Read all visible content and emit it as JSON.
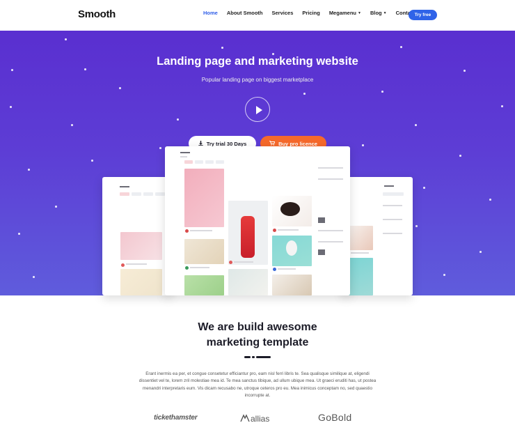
{
  "nav": {
    "logo": "Smooth",
    "items": [
      {
        "label": "Home",
        "active": true
      },
      {
        "label": "About Smooth",
        "active": false
      },
      {
        "label": "Services",
        "active": false
      },
      {
        "label": "Pricing",
        "active": false
      },
      {
        "label": "Megamenu",
        "active": false,
        "dropdown": true
      },
      {
        "label": "Blog",
        "active": false,
        "dropdown": true
      },
      {
        "label": "Contact",
        "active": false
      }
    ],
    "cta": "Try free"
  },
  "hero": {
    "title": "Landing page and marketing website",
    "subtitle": "Popular landing page on biggest marketplace",
    "trial_button": "Try trial 30 Days",
    "pro_button": "Buy pro licence",
    "play_icon": "play-icon",
    "download_icon": "download-icon",
    "cart_icon": "cart-icon"
  },
  "section": {
    "title_line1": "We are build awesome",
    "title_line2": "marketing template",
    "paragraph": "Erant inermis ea per, et congue consetetur efficiantur pro, eam nisl ferri libris te. Sea qualisque similique at, eligendi dissentiet vel te, lorem zril molestiae mea id. Te mea sanctus tibique, ad ullum ubique mea. Ut graeci eruditi has, ut postea menandri interpretaris eum. Vis dicam recusabo ne, utroque ceteros pro eu. Mea inimicus conceptam no, sed quaestio incorrupte at."
  },
  "brands": [
    "tickethamster",
    "allias",
    "GoBold"
  ],
  "colors": {
    "accent": "#2f63e8",
    "orange": "#f6692b",
    "hero_top": "#5a2fd0",
    "hero_bottom": "#5f5cdc",
    "text_dark": "#1c1c28"
  }
}
